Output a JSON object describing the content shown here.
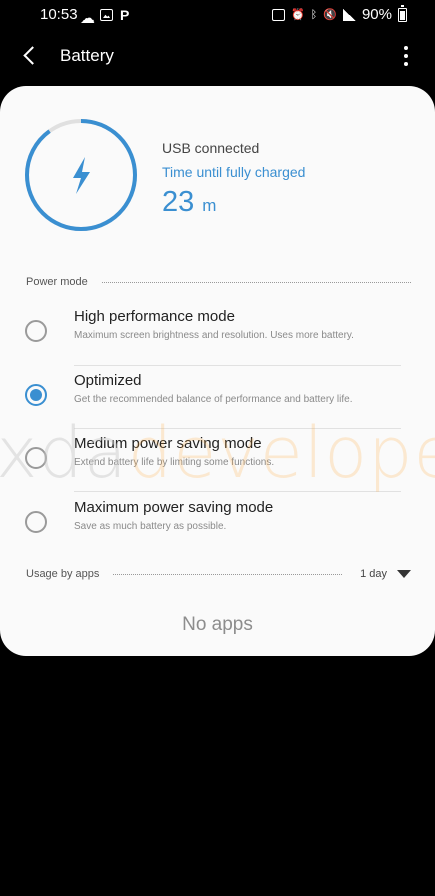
{
  "status_bar": {
    "time": "10:53",
    "battery_percent": "90%",
    "left_icons": [
      "cloud-icon",
      "image-icon",
      "p-icon"
    ],
    "right_icons": [
      "nfc-icon",
      "alarm-icon",
      "bluetooth-icon",
      "mute-icon",
      "signal-icon",
      "battery-icon"
    ]
  },
  "app_bar": {
    "title": "Battery"
  },
  "charge": {
    "status": "USB connected",
    "label": "Time until fully charged",
    "time_value": "23",
    "time_unit": "m",
    "ring_color": "#3a8fd1"
  },
  "power_mode": {
    "header": "Power mode",
    "selected_index": 1,
    "modes": [
      {
        "title": "High performance mode",
        "desc": "Maximum screen brightness and resolution. Uses more battery."
      },
      {
        "title": "Optimized",
        "desc": "Get the recommended balance of performance and battery life."
      },
      {
        "title": "Medium power saving mode",
        "desc": "Extend battery life by limiting some functions."
      },
      {
        "title": "Maximum power saving mode",
        "desc": "Save as much battery as possible."
      }
    ]
  },
  "usage": {
    "header": "Usage by apps",
    "period": "1 day",
    "empty_text": "No apps"
  },
  "watermark": {
    "part1": "xda",
    "part2": "developers"
  },
  "colors": {
    "accent": "#3a8fd1",
    "background": "#000000",
    "card": "#fafafa"
  }
}
